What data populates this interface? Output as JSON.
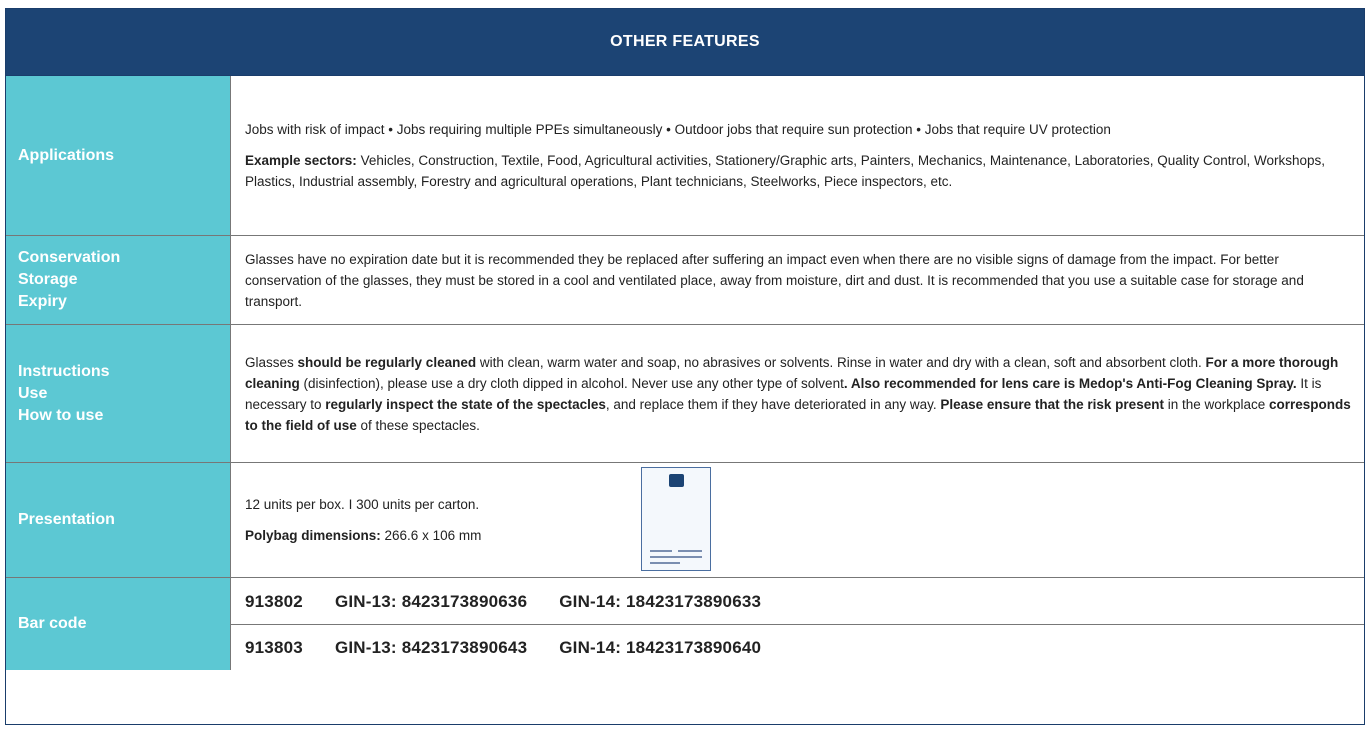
{
  "header": {
    "title": "OTHER FEATURES"
  },
  "applications": {
    "label": "Applications",
    "text": "Jobs with risk of impact • Jobs requiring multiple PPEs simultaneously • Outdoor jobs that require sun protection • Jobs that require UV protection",
    "sectors_label": "Example sectors:",
    "sectors_text": " Vehicles, Construction, Textile, Food, Agricultural activities, Stationery/Graphic arts, Painters, Mechanics, Maintenance, Laboratories, Quality Control, Workshops, Plastics, Industrial assembly, Forestry and agricultural operations, Plant technicians, Steelworks, Piece inspectors, etc."
  },
  "conservation": {
    "label_lines": [
      "Conservation",
      "Storage",
      "Expiry"
    ],
    "text": "Glasses have no expiration date but it is recommended they be replaced after suffering an impact even when there are no visible signs of damage from the impact. For better conservation of the glasses, they must be stored in a cool and ventilated place, away from moisture, dirt and dust. It is recommended that you use a suitable case for storage and transport."
  },
  "instructions": {
    "label_lines": [
      "Instructions",
      "Use",
      "How to use"
    ],
    "t1": "Glasses ",
    "b1": "should be regularly cleaned",
    "t2": " with clean, warm water and soap, no abrasives or solvents. Rinse in water and dry with a clean, soft and absorbent cloth. ",
    "b2": "For a more thorough cleaning",
    "t3": " (disinfection), please use a dry cloth dipped in alcohol. Never use any other type of solvent",
    "b3": ". Also recommended for lens care is Medop's Anti-Fog Cleaning Spray.",
    "t4": " It is necessary to ",
    "b4": "regularly inspect the state of the spectacles",
    "t5": ", and replace them if they have deteriorated in any way. ",
    "b5": "Please ensure that the risk present",
    "t6": " in the workplace ",
    "b6": "corresponds to the field of use",
    "t7": " of these spectacles."
  },
  "presentation": {
    "label": "Presentation",
    "units": "12 units per box.  I  300 units per carton.",
    "dims_label": "Polybag dimensions:",
    "dims_value": " 266.6 x 106 mm",
    "image_icon": "polybag-label-image"
  },
  "barcode": {
    "label": "Bar code",
    "rows": [
      {
        "code": "913802",
        "gin13": "GIN-13: 8423173890636",
        "gin14": "GIN-14: 18423173890633"
      },
      {
        "code": "913803",
        "gin13": "GIN-13: 8423173890643",
        "gin14": "GIN-14: 18423173890640"
      }
    ]
  },
  "colors": {
    "header_bg": "#1c4474",
    "label_bg": "#5cc8d3"
  }
}
